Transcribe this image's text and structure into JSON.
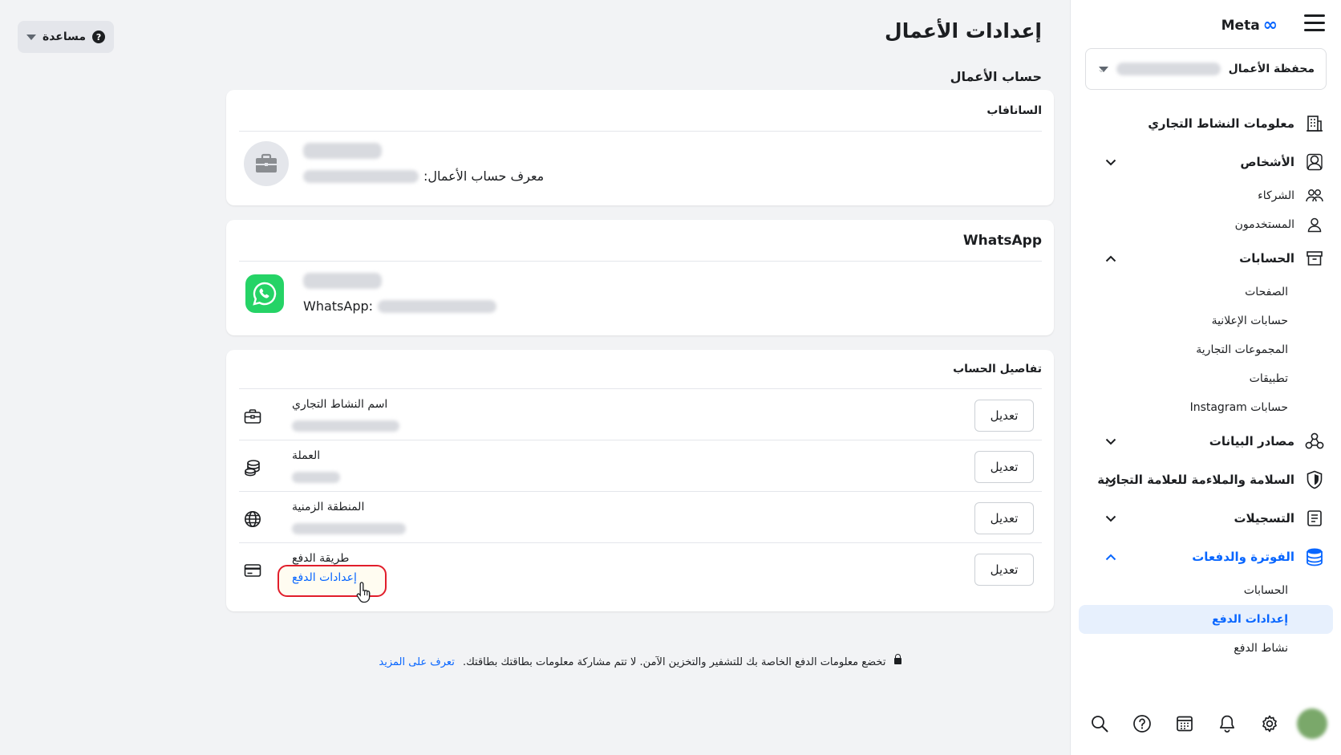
{
  "app": {
    "brand": "Meta",
    "accent": "#0866ff",
    "highlight_color": "#e11d2b"
  },
  "help": {
    "label": "مساعدة"
  },
  "sidebar": {
    "portfolio_label": "محفظة الأعمال",
    "items": [
      {
        "label": "معلومات النشاط التجاري",
        "icon": "building-icon"
      },
      {
        "label": "الأشخاص",
        "icon": "person-icon",
        "expanded": false
      },
      {
        "label": "الشركاء",
        "icon": "partners-icon"
      },
      {
        "label": "المستخدمون",
        "icon": "user-icon"
      },
      {
        "label": "الحسابات",
        "icon": "archive-icon",
        "expanded": true
      },
      {
        "label": "الصفحات"
      },
      {
        "label": "حسابات الإعلانية"
      },
      {
        "label": "المجموعات التجارية"
      },
      {
        "label": "تطبيقات"
      },
      {
        "label": "حسابات Instagram"
      },
      {
        "label": "مصادر البيانات",
        "icon": "data-sources-icon",
        "expanded": false
      },
      {
        "label": "السلامة والملاءمة للعلامة التجارية",
        "icon": "shield-icon",
        "expanded": false
      },
      {
        "label": "التسجيلات",
        "icon": "log-icon",
        "expanded": false
      },
      {
        "label": "الفوترة والدفعات",
        "icon": "billing-icon",
        "expanded": true,
        "active": true
      },
      {
        "label": "الحسابات"
      },
      {
        "label": "إعدادات الدفع",
        "selected": true
      },
      {
        "label": "نشاط الدفع"
      }
    ],
    "bottom_icons": [
      "avatar",
      "gear-icon",
      "bell-icon",
      "calendar-icon",
      "help-icon",
      "search-icon"
    ]
  },
  "main": {
    "title": "إعدادات الأعمال",
    "section_title": "حساب الأعمال",
    "business_card": {
      "header": "السانافاب",
      "id_label": "معرف حساب الأعمال:"
    },
    "whatsapp_card": {
      "header": "WhatsApp",
      "id_label": "WhatsApp:"
    },
    "details_card": {
      "header": "تفاصيل الحساب",
      "edit_label": "تعديل",
      "rows": [
        {
          "label": "اسم النشاط التجاري",
          "icon": "briefcase-icon"
        },
        {
          "label": "العملة",
          "icon": "coins-icon"
        },
        {
          "label": "المنطقة الزمنية",
          "icon": "globe-icon"
        },
        {
          "label": "طريقة الدفع",
          "icon": "credit-card-icon",
          "link": "إعدادات الدفع"
        }
      ]
    },
    "footer": {
      "note": "تخضع معلومات الدفع الخاصة بك للتشفير والتخزين الآمن. لا تتم مشاركة معلومات بطاقتك بطاقتك.",
      "link": "تعرف على المزيد"
    }
  }
}
